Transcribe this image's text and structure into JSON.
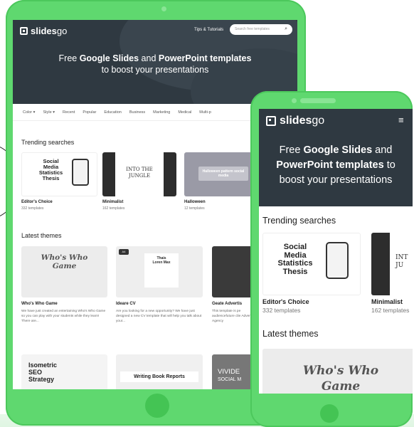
{
  "brand": {
    "name_bold": "slides",
    "name_rest": "go"
  },
  "tablet": {
    "header": {
      "tips": "Tips & Tutorials",
      "search_placeholder": "Search free templates"
    },
    "hero": {
      "pre": "Free ",
      "b1": "Google Slides",
      "mid": " and ",
      "b2": "PowerPoint templates",
      "line2": "to boost your presentations"
    },
    "categories": [
      "Color ▾",
      "Style ▾",
      "Recent",
      "Popular",
      "Education",
      "Business",
      "Marketing",
      "Medical",
      "Multi-p"
    ],
    "trending_title": "Trending searches",
    "trending": [
      {
        "name": "Editor's Choice",
        "count": "332 templates"
      },
      {
        "name": "Minimalist",
        "count": "162 templates"
      },
      {
        "name": "Halloween",
        "count": "12 templates"
      }
    ],
    "latest_title": "Latest themes",
    "latest": [
      {
        "name": "Who's Who Game",
        "desc": "We have just created an entertaining Who's Who Game so you can play with your students while they learn! There are..."
      },
      {
        "name": "Ideare CV",
        "desc": "Are you looking for a new opportunity? We have just designed a new CV template that will help you talk about your..."
      },
      {
        "name": "Geate Advertis",
        "desc": "This template is pe audiencefuture clie Advertising Agency"
      }
    ],
    "thumb_text": {
      "smt": [
        "Social",
        "Media",
        "Statistics",
        "Thesis"
      ],
      "jungle": [
        "INTO THE",
        "JUNGLE"
      ],
      "halloween": "Halloween pattern social media",
      "who": [
        "Who's Who",
        "Game"
      ],
      "cv": [
        "Thais",
        "Loren Max"
      ],
      "cv_badge": "A4",
      "iso": [
        "Isometric",
        "SEO",
        "Strategy"
      ],
      "wbr": "Writing Book Reports",
      "vid": [
        "VIVIDE",
        "SOCIAL M"
      ]
    }
  },
  "phone": {
    "menu_icon": "≡",
    "hero": {
      "pre": "Free ",
      "b1": "Google Slides",
      "mid": " and ",
      "b2": "PowerPoint templates",
      "mid2": " to",
      "line3": "boost your presentations"
    },
    "trending_title": "Trending searches",
    "trending": [
      {
        "name": "Editor's Choice",
        "count": "332 templates"
      },
      {
        "name": "Minimalist",
        "count": "162 templates"
      }
    ],
    "latest_title": "Latest themes",
    "thumb_text": {
      "smt": [
        "Social",
        "Media",
        "Statistics",
        "Thesis"
      ],
      "jungle": [
        "INT",
        "JU"
      ],
      "who": [
        "Who's Who",
        "Game"
      ]
    }
  }
}
